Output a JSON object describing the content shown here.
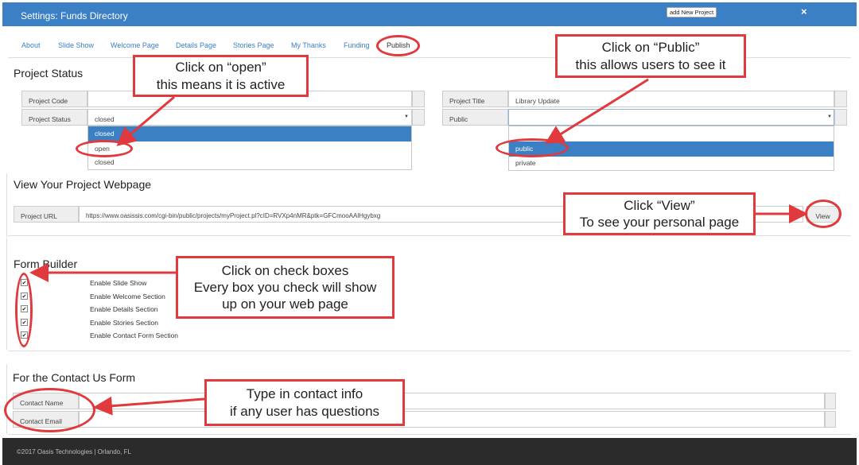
{
  "header": {
    "title": "Settings: Funds Directory",
    "add_button": "add New Project",
    "close_icon": "×"
  },
  "tabs": [
    "About",
    "Slide Show",
    "Welcome Page",
    "Details Page",
    "Stories Page",
    "My Thanks",
    "Funding",
    "Publish"
  ],
  "project_status": {
    "title": "Project Status",
    "code_label": "Project Code",
    "status_label": "Project Status",
    "status_value": "closed",
    "status_options": [
      "closed",
      "open",
      "closed"
    ],
    "project_title_label": "Project Title",
    "project_title_value": "Library Update",
    "public_label": "Public",
    "public_value": "",
    "public_options": [
      "",
      "public",
      "private"
    ]
  },
  "webpage": {
    "title": "View Your Project Webpage",
    "url_label": "Project URL",
    "url_value": "https://www.oasissis.com/cgi-bin/public/projects/myProject.pl?cID=RVXp4nMR&ptk=GFCmooAAlHgybxg",
    "view_button": "View"
  },
  "form_builder": {
    "title": "Form Builder",
    "items": [
      "Enable Slide Show",
      "Enable Welcome Section",
      "Enable Details Section",
      "Enable Stories Section",
      "Enable Contact Form Section"
    ]
  },
  "contact": {
    "title": "For the Contact Us Form",
    "name_label": "Contact Name",
    "email_label": "Contact Email"
  },
  "callouts": {
    "open": [
      "Click on “open”",
      "this means it is active"
    ],
    "public": [
      "Click on “Public”",
      "this allows users to see it"
    ],
    "view": [
      "Click “View”",
      "To see your personal page"
    ],
    "checkboxes": [
      "Click on check boxes",
      "Every box you check will show",
      "up on your web page"
    ],
    "contact": [
      "Type in contact info",
      "if any user has questions"
    ]
  },
  "footer": {
    "text": "©2017 Oasis Technologies | Orlando, FL"
  },
  "colors": {
    "header": "#3b7fc4",
    "annotation": "#e03a3e",
    "selected": "#3b7fc4",
    "footer": "#2b2b2b"
  }
}
